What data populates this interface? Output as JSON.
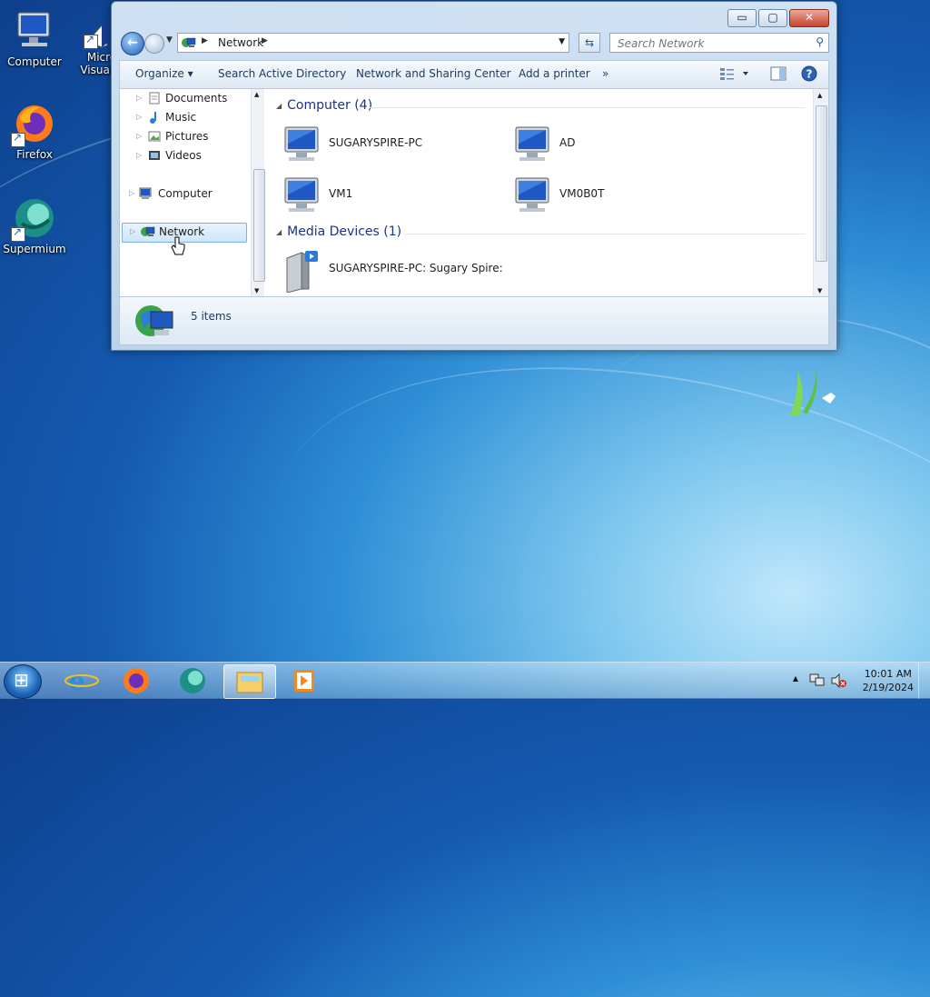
{
  "desktop": {
    "icons": [
      {
        "label": "Computer"
      },
      {
        "label": "Micro Visual S"
      },
      {
        "label": "Firefox"
      },
      {
        "label": "Supermium"
      }
    ]
  },
  "window": {
    "controls": {
      "minimize": "▭",
      "maximize": "▢",
      "close": "✕"
    },
    "address": {
      "crumb": "Network"
    },
    "search": {
      "placeholder": "Search Network"
    },
    "toolbar": {
      "organize": "Organize",
      "search_ad": "Search Active Directory",
      "network_center": "Network and Sharing Center",
      "add_printer": "Add a printer",
      "more": "»"
    },
    "navpane": {
      "items": [
        {
          "label": "Documents"
        },
        {
          "label": "Music"
        },
        {
          "label": "Pictures"
        },
        {
          "label": "Videos"
        },
        {
          "label": "Computer"
        },
        {
          "label": "Network"
        }
      ]
    },
    "groups": [
      {
        "title": "Computer (4)",
        "items": [
          {
            "label": "SUGARYSPIRE-PC"
          },
          {
            "label": "AD"
          },
          {
            "label": "VM1"
          },
          {
            "label": "VM0B0T"
          }
        ]
      },
      {
        "title": "Media Devices (1)",
        "items": [
          {
            "label": "SUGARYSPIRE-PC: Sugary Spire:"
          }
        ]
      }
    ],
    "details": {
      "count": "5 items"
    }
  },
  "taskbar": {
    "clock": {
      "time": "10:01 AM",
      "date": "2/19/2024"
    },
    "tray_arrow": "▲"
  },
  "colors": {
    "group_heading": "#1e3287",
    "selection": "#cde6fb",
    "accent": "#1d5a9b"
  }
}
